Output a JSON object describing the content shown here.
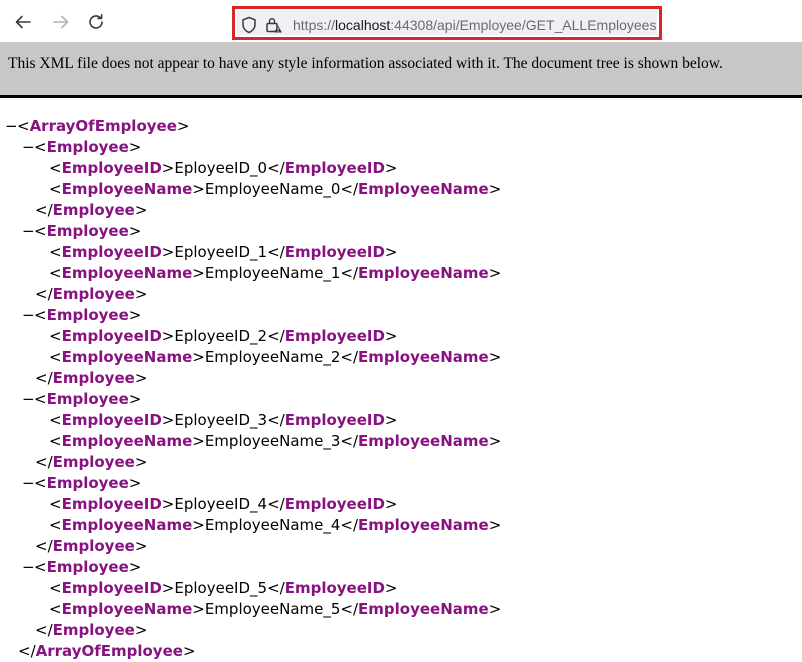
{
  "browser": {
    "url_scheme": "https://",
    "url_host": "localhost",
    "url_rest": ":44308/api/Employee/GET_ALLEmployees"
  },
  "banner": {
    "text": "This XML file does not appear to have any style information associated with it. The document tree is shown below."
  },
  "xml": {
    "collapse_glyph": "−",
    "root_tag": "ArrayOfEmployee",
    "item_tag": "Employee",
    "id_tag": "EmployeeID",
    "name_tag": "EmployeeName",
    "employees": [
      {
        "id": "EployeeID_0",
        "name": "EmployeeName_0"
      },
      {
        "id": "EployeeID_1",
        "name": "EmployeeName_1"
      },
      {
        "id": "EployeeID_2",
        "name": "EmployeeName_2"
      },
      {
        "id": "EployeeID_3",
        "name": "EmployeeName_3"
      },
      {
        "id": "EployeeID_4",
        "name": "EmployeeName_4"
      },
      {
        "id": "EployeeID_5",
        "name": "EmployeeName_5"
      }
    ]
  },
  "colors": {
    "tag": "#881280",
    "highlight_border": "#d9262a",
    "banner_bg": "#c7c7c7"
  }
}
